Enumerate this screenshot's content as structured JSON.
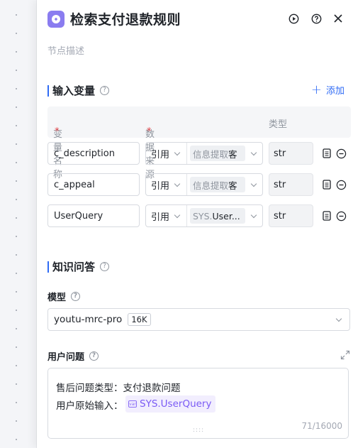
{
  "header": {
    "title": "检索支付退款规则",
    "node_icon": "node-type-icon",
    "run_icon": "play-circle-icon",
    "help_icon": "help-circle-icon",
    "close_icon": "close-icon"
  },
  "description_placeholder": "节点描述",
  "input_section": {
    "title": "输入变量",
    "add_label": "添加",
    "columns": {
      "name": "变量名称",
      "source": "数据来源",
      "type": "类型",
      "required_mark": "*"
    },
    "rows": [
      {
        "name": "c_description",
        "ref": "引用",
        "source_prefix": "信息提取",
        "source_suffix": "客",
        "type": "str"
      },
      {
        "name": "c_appeal",
        "ref": "引用",
        "source_prefix": "信息提取",
        "source_suffix": "客",
        "type": "str"
      },
      {
        "name": "UserQuery",
        "ref": "引用",
        "source_prefix": "SYS.",
        "source_suffix": "User...",
        "type": "str"
      }
    ]
  },
  "kb_section": {
    "title": "知识问答",
    "model_label": "模型",
    "model_value": "youtu-mrc-pro",
    "model_badge": "16K",
    "question_label": "用户问题",
    "question_line1": "售后问题类型：支付退款问题",
    "question_line2_prefix": "用户原始输入：",
    "question_var": "SYS.UserQuery",
    "counter": "71/16000"
  },
  "colors": {
    "accent": "#2f6bf5",
    "node_icon": "#8a7cf0",
    "variable": "#7a5af5",
    "required": "#e5484d"
  }
}
